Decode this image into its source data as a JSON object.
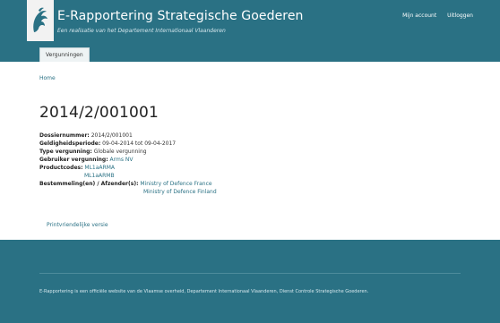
{
  "header": {
    "title": "E-Rapportering Strategische Goederen",
    "subtitle": "Een realisatie van het Departement Internationaal Vlaanderen",
    "links": {
      "account": "Mijn account",
      "logout": "Uitloggen"
    }
  },
  "tabs": [
    {
      "label": "Vergunningen"
    }
  ],
  "breadcrumb": {
    "home": "Home"
  },
  "page": {
    "title": "2014/2/001001",
    "fields": {
      "dossier_label": "Dossiernummer:",
      "dossier_value": "2014/2/001001",
      "validity_label": "Geldigheidsperiode:",
      "validity_value": "09-04-2014 tot 09-04-2017",
      "type_label": "Type vergunning:",
      "type_value": "Globale vergunning",
      "user_label": "Gebruiker vergunning:",
      "user_value": "Arms NV",
      "codes_label": "Productcodes:",
      "codes": [
        "ML1aARMA",
        "ML1aARMB"
      ],
      "dest_label": "Bestemmeling(en) / Afzender(s):",
      "destinations": [
        "Ministry of Defence France",
        "Ministry of Defence Finland"
      ]
    },
    "print_link": "Printvriendelijke versie"
  },
  "footer": {
    "text": "E-Rapportering is een officiële website van de Vlaamse overheid, Departement Internationaal Vlaanderen, Dienst Controle Strategische Goederen."
  },
  "colors": {
    "primary": "#2a7184",
    "link": "#2a7184"
  },
  "icons": {
    "logo": "flemish-lion-logo"
  }
}
